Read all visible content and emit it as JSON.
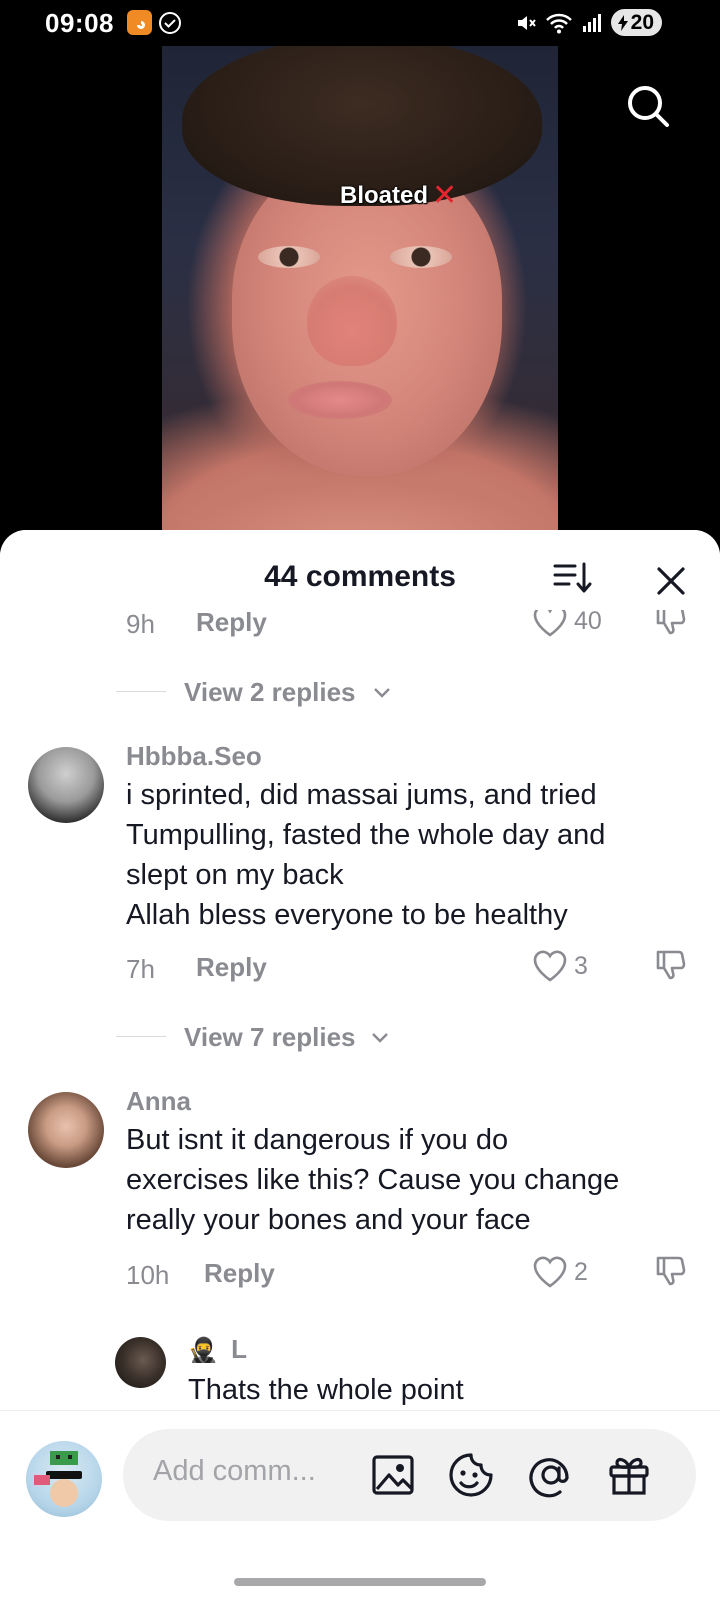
{
  "status_bar": {
    "time": "09:08",
    "battery": "20",
    "icons": [
      "app-icon",
      "check-circle-icon",
      "mute-icon",
      "wifi-icon",
      "signal-icon",
      "battery-icon"
    ]
  },
  "video": {
    "overlay_text": "Bloated",
    "overlay_mark": "✕"
  },
  "sheet": {
    "title": "44 comments"
  },
  "comments": {
    "prev": {
      "time": "9h",
      "reply": "Reply",
      "likes": "40"
    },
    "view_replies_1": "View 2 replies",
    "c1": {
      "user": "Hbbba.Seo",
      "lines": [
        "i sprinted, did massai jums, and tried",
        "Tumpulling, fasted the whole day and",
        "slept on my back",
        "Allah bless everyone to be healthy"
      ],
      "time": "7h",
      "reply": "Reply",
      "likes": "3"
    },
    "view_replies_2": "View 7 replies",
    "c2": {
      "user": "Anna",
      "lines": [
        "But isnt it dangerous if you do",
        "exercises like this? Cause you change",
        "really your bones and your face"
      ],
      "time": "10h",
      "reply": "Reply",
      "likes": "2"
    },
    "c3": {
      "user_emoji": "🥷",
      "user": "L",
      "text": "Thats the whole point"
    }
  },
  "input": {
    "placeholder": "Add comm..."
  },
  "colors": {
    "text_primary": "#161823",
    "text_secondary": "#8a8b91",
    "overlay_cross": "#e6262e"
  }
}
